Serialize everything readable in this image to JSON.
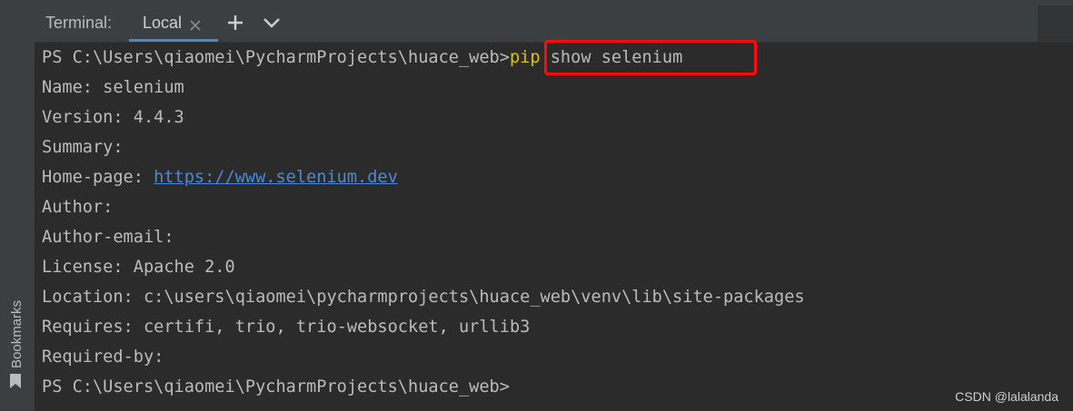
{
  "header": {
    "title": "Terminal:",
    "tab_label": "Local"
  },
  "sidebar": {
    "bookmarks_label": "Bookmarks"
  },
  "terminal": {
    "prompt": "PS C:\\Users\\qiaomei\\PycharmProjects\\huace_web>",
    "command_pip": "pip",
    "command_rest": " show selenium",
    "name_line": "Name: selenium",
    "version_line": "Version: 4.4.3",
    "summary_line": "Summary:",
    "homepage_label": "Home-page: ",
    "homepage_url": "https://www.selenium.dev",
    "author_line": "Author:",
    "author_email_line": "Author-email:",
    "license_line": "License: Apache 2.0",
    "location_line": "Location: c:\\users\\qiaomei\\pycharmprojects\\huace_web\\venv\\lib\\site-packages",
    "requires_line": "Requires: certifi, trio, trio-websocket, urllib3",
    "required_by_line": "Required-by:",
    "final_prompt": "PS C:\\Users\\qiaomei\\PycharmProjects\\huace_web>"
  },
  "watermark": "CSDN @lalalanda",
  "colors": {
    "accent": "#4a88c7",
    "highlight_border": "#ff0a0a",
    "pip_keyword": "#e5c100",
    "link": "#4a88d9"
  },
  "icons": {
    "tab_close": "close-icon",
    "add": "plus-icon",
    "dropdown": "chevron-down-icon",
    "bookmark": "bookmark-icon"
  }
}
